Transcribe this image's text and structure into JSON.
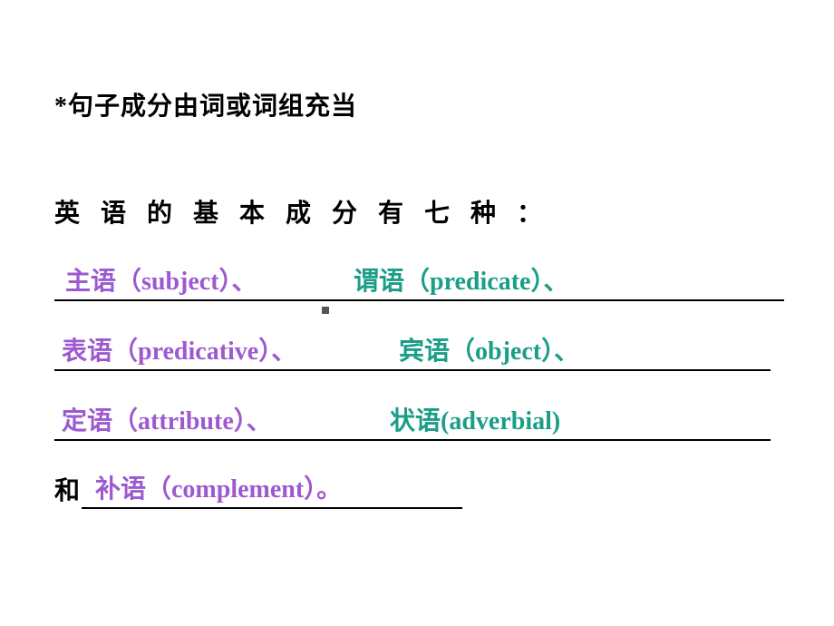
{
  "line1": "*句子成分由词或词组充当",
  "line2": "英语的基本成分有七种：",
  "row1_left": "主语（subject）、",
  "row1_right": "谓语（predicate）、",
  "row2_left": "表语（predicative）、",
  "row2_right": "宾语（object）、",
  "row3_left": "定语（attribute）、",
  "row3_right": "状语(adverbial)",
  "and": "和",
  "row4": "补语（complement）。"
}
